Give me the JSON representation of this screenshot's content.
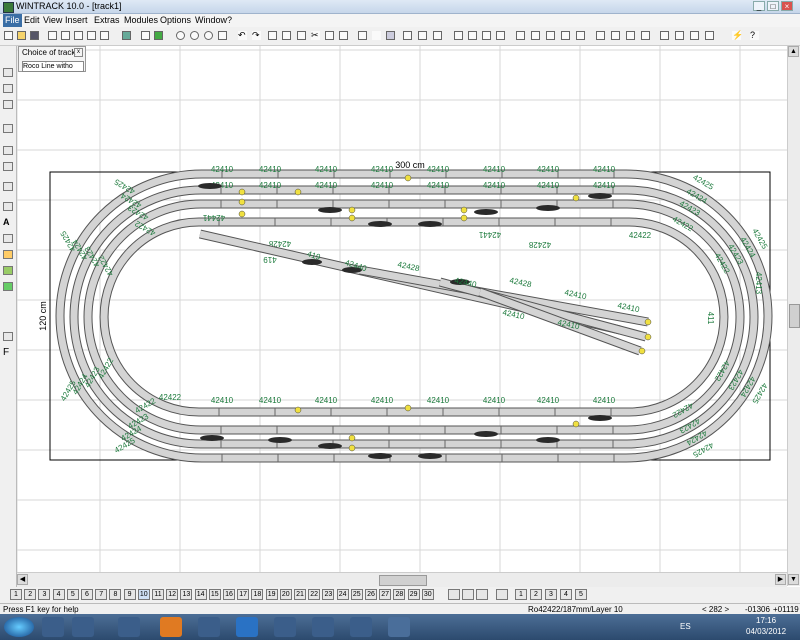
{
  "window": {
    "title": "WINTRACK 10.0 - [track1]"
  },
  "menu": [
    "File",
    "Edit",
    "View",
    "Insert",
    "Extras",
    "Modules",
    "Options",
    "Window",
    "?"
  ],
  "choice_panel": {
    "title": "Choice of track",
    "selected": "Roco Line witho"
  },
  "dimensions": {
    "width_label": "300 cm",
    "height_label": "120 cm"
  },
  "track_labels": {
    "straight": "42410",
    "curve_r1": "42422",
    "curve_r2": "42423",
    "curve_r3": "42424",
    "curve_r4": "42425",
    "turnout_a": "42441",
    "turnout_b": "42440",
    "turnout_c": "42428",
    "short": "419",
    "short_b": "411",
    "short_c": "42413"
  },
  "layers": [
    "1",
    "2",
    "3",
    "4",
    "5",
    "6",
    "7",
    "8",
    "9",
    "10",
    "11",
    "12",
    "13",
    "14",
    "15",
    "16",
    "17",
    "18",
    "19",
    "20",
    "21",
    "22",
    "23",
    "24",
    "25",
    "26",
    "27",
    "28",
    "29",
    "30",
    "1",
    "2",
    "3",
    "4",
    "5"
  ],
  "status": {
    "help": "Press F1 key for help",
    "track_info": "Ro42422/187mm/Layer 10",
    "zoom": "< 282 >",
    "coord_x": "-01306",
    "coord_y": "+01119"
  },
  "taskbar": {
    "lang": "ES",
    "time": "17:16",
    "date": "04/03/2012"
  },
  "colors": {
    "label_green": "#1c7a3c",
    "track_fill": "#d4d4d4",
    "track_edge": "#555555",
    "turnout_dark": "#2a2a2a",
    "marker_yellow": "#f0e040"
  }
}
